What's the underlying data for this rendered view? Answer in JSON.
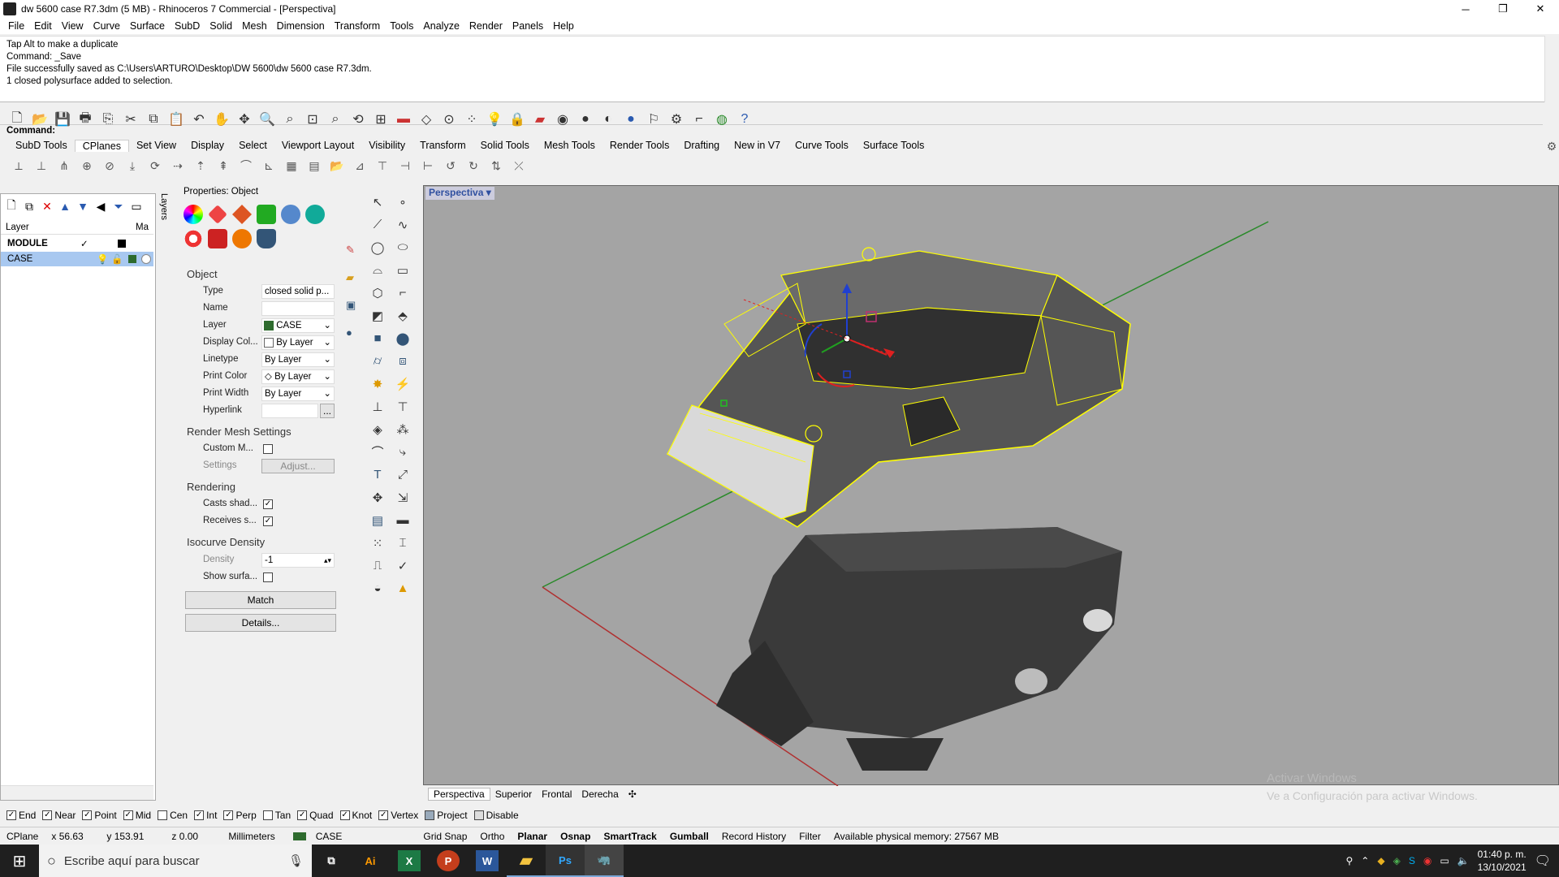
{
  "window": {
    "title": "dw 5600 case R7.3dm (5 MB) - Rhinoceros 7 Commercial - [Perspectiva]",
    "min": "─",
    "restore": "❐",
    "close": "✕"
  },
  "menu": [
    "File",
    "Edit",
    "View",
    "Curve",
    "Surface",
    "SubD",
    "Solid",
    "Mesh",
    "Dimension",
    "Transform",
    "Tools",
    "Analyze",
    "Render",
    "Panels",
    "Help"
  ],
  "command": {
    "lines": [
      "Tap Alt to make a duplicate",
      "Command: _Save",
      "File successfully saved as C:\\Users\\ARTURO\\Desktop\\DW 5600\\dw 5600 case R7.3dm.",
      "1 closed polysurface added to selection."
    ],
    "prompt": "Command:"
  },
  "tabs": [
    "SubD Tools",
    "CPlanes",
    "Set View",
    "Display",
    "Select",
    "Viewport Layout",
    "Visibility",
    "Transform",
    "Solid Tools",
    "Mesh Tools",
    "Render Tools",
    "Drafting",
    "New in V7",
    "Curve Tools",
    "Surface Tools"
  ],
  "layers": {
    "col_layer": "Layer",
    "col_ma": "Ma",
    "side_label": "Layers",
    "rows": [
      {
        "name": "MODULE",
        "check": "✓"
      },
      {
        "name": "CASE",
        "check": ""
      }
    ]
  },
  "properties": {
    "title": "Properties: Object",
    "sec_object": "Object",
    "type_label": "Type",
    "type_value": "closed solid p...",
    "name_label": "Name",
    "name_value": "",
    "layer_label": "Layer",
    "layer_value": "CASE",
    "dispcol_label": "Display Col...",
    "dispcol_value": "By Layer",
    "linetype_label": "Linetype",
    "linetype_value": "By Layer",
    "printcolor_label": "Print Color",
    "printcolor_value": "By Layer",
    "printwidth_label": "Print Width",
    "printwidth_value": "By Layer",
    "hyperlink_label": "Hyperlink",
    "hyperlink_btn": "...",
    "sec_rendermesh": "Render Mesh Settings",
    "custom_label": "Custom M...",
    "settings_label": "Settings",
    "adjust_btn": "Adjust...",
    "sec_rendering": "Rendering",
    "casts_label": "Casts shad...",
    "receives_label": "Receives s...",
    "sec_isocurve": "Isocurve Density",
    "density_label": "Density",
    "density_value": "-1",
    "showsurf_label": "Show surfa...",
    "match_btn": "Match",
    "details_btn": "Details..."
  },
  "viewport": {
    "title": "Perspectiva",
    "tabs": [
      "Perspectiva",
      "Superior",
      "Frontal",
      "Derecha"
    ],
    "add_tab": "✣",
    "watermark1": "Activar Windows",
    "watermark2": "Ve a Configuración para activar Windows."
  },
  "osnaps": [
    {
      "label": "End",
      "on": true
    },
    {
      "label": "Near",
      "on": true
    },
    {
      "label": "Point",
      "on": true
    },
    {
      "label": "Mid",
      "on": true
    },
    {
      "label": "Cen",
      "on": false
    },
    {
      "label": "Int",
      "on": true
    },
    {
      "label": "Perp",
      "on": true
    },
    {
      "label": "Tan",
      "on": false
    },
    {
      "label": "Quad",
      "on": true
    },
    {
      "label": "Knot",
      "on": true
    },
    {
      "label": "Vertex",
      "on": true
    },
    {
      "label": "Project",
      "on": false
    },
    {
      "label": "Disable",
      "on": false
    }
  ],
  "status": {
    "cplane": "CPlane",
    "x": "x 56.63",
    "y": "y 153.91",
    "z": "z 0.00",
    "units": "Millimeters",
    "layer": "CASE",
    "gridsnap": "Grid Snap",
    "ortho": "Ortho",
    "planar": "Planar",
    "osnap": "Osnap",
    "smarttrack": "SmartTrack",
    "gumball": "Gumball",
    "recordhistory": "Record History",
    "filter": "Filter",
    "memory": "Available physical memory: 27567 MB"
  },
  "taskbar": {
    "search": "Escribe aquí para buscar",
    "time": "01:40 p. m.",
    "date": "13/10/2021"
  },
  "colors": {
    "viewport_bg": "#a4a4a4",
    "selection": "#ffff00",
    "case_layer": "#2e6b2e",
    "accent": "#3050a0"
  }
}
